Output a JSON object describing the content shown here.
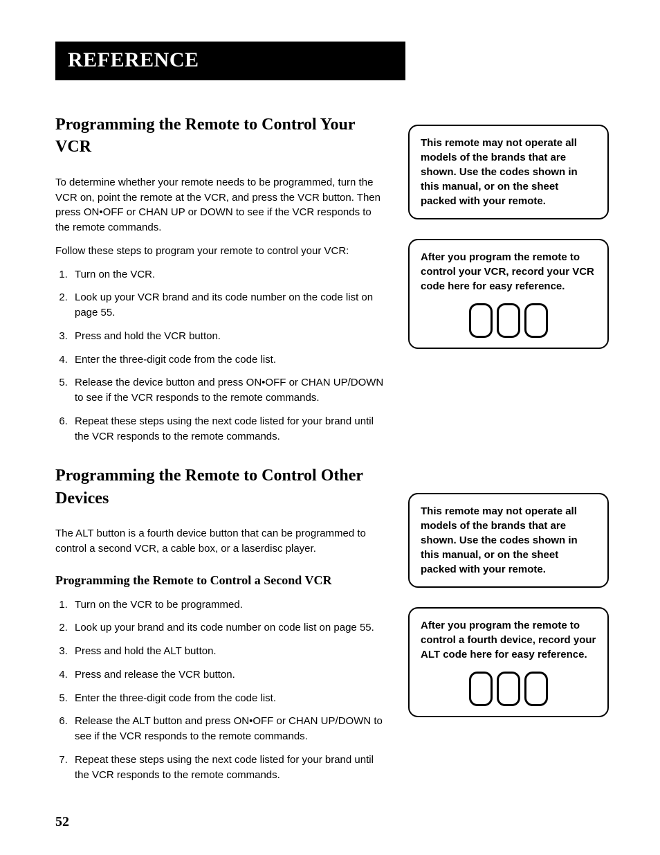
{
  "banner": "REFERENCE",
  "section1": {
    "title": "Programming the Remote to Control Your VCR",
    "intro": "To determine whether your remote needs to be programmed, turn the VCR on, point the remote at the VCR, and press the VCR button. Then press ON•OFF or CHAN UP or DOWN to see if the VCR responds to the remote commands.",
    "follow": " Follow these steps to program your remote to control your VCR:",
    "steps": [
      "Turn on the VCR.",
      "Look up your VCR brand and its code number on the code list on page 55.",
      "Press and hold the VCR button.",
      "Enter the three-digit code from the code list.",
      "Release the device button and press ON•OFF or CHAN UP/DOWN to see if the VCR responds to the remote commands.",
      "Repeat these steps using the next code listed for your brand until the VCR responds to the remote commands."
    ]
  },
  "section2": {
    "title": "Programming the Remote to Control Other Devices",
    "intro": "The ALT button is a fourth device button that can be programmed to control a second VCR, a cable box, or a laserdisc player.",
    "subheading": "Programming the Remote to Control a Second VCR",
    "steps": [
      "Turn on the VCR to be programmed.",
      "Look up your brand and its code number on code list on page 55.",
      "Press and hold the ALT button.",
      "Press and release the VCR button.",
      "Enter the three-digit code from the code list.",
      "Release the ALT button and press ON•OFF or CHAN UP/DOWN to see if the VCR responds to the remote commands.",
      "Repeat these steps using the next code listed for your brand until the VCR responds to the remote commands."
    ]
  },
  "callouts": {
    "note1": "This remote may not operate all models of the brands that are shown. Use the codes shown in this manual, or on the sheet packed with your remote.",
    "record1": "After you program the remote to control your VCR, record your VCR code here for easy reference.",
    "note2": "This remote may not operate all models of the brands that are shown. Use the codes shown in this manual, or on the sheet packed with your remote.",
    "record2": "After you program the remote to control a fourth device, record your ALT code here for easy reference."
  },
  "page_number": "52"
}
